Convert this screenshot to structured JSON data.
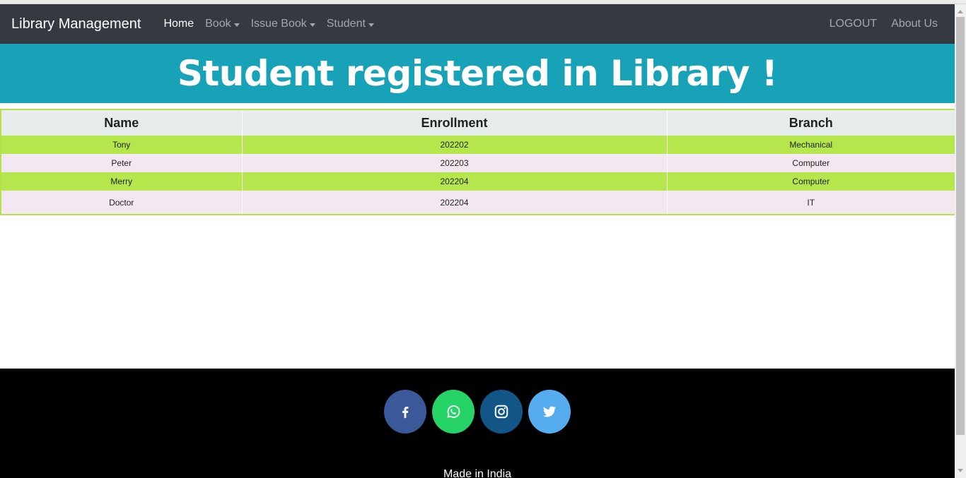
{
  "navbar": {
    "brand": "Library Management",
    "items": [
      {
        "label": "Home"
      },
      {
        "label": "Book"
      },
      {
        "label": "Issue Book"
      },
      {
        "label": "Student"
      }
    ],
    "right": [
      {
        "label": "LOGOUT"
      },
      {
        "label": "About Us"
      }
    ]
  },
  "banner": {
    "title": "Student registered in Library !"
  },
  "table": {
    "headers": [
      "Name",
      "Enrollment",
      "Branch"
    ],
    "rows": [
      [
        "Tony",
        "202202",
        "Mechanical"
      ],
      [
        "Peter",
        "202203",
        "Computer"
      ],
      [
        "Merry",
        "202204",
        "Computer"
      ],
      [
        "Doctor",
        "202204",
        "IT"
      ]
    ]
  },
  "footer": {
    "socials": [
      {
        "icon": "facebook-icon",
        "color": "#3b5998"
      },
      {
        "icon": "whatsapp-icon",
        "color": "#25d366"
      },
      {
        "icon": "instagram-icon",
        "color": "#125688"
      },
      {
        "icon": "twitter-icon",
        "color": "#55acee"
      }
    ],
    "text": "Made in India"
  },
  "colors": {
    "navbar": "#343a40",
    "banner": "#17a2b8",
    "row_odd": "#b5e64b",
    "row_even": "#f3e8ef",
    "header_bg": "#e6ece9",
    "border": "#b5e14a"
  }
}
